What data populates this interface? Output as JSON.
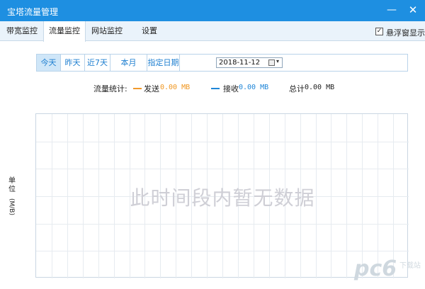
{
  "window": {
    "title": "宝塔流量管理",
    "min_symbol": "—",
    "close_symbol": "✕"
  },
  "tabs": [
    {
      "label": "带宽监控"
    },
    {
      "label": "流量监控"
    },
    {
      "label": "网站监控"
    },
    {
      "label": "设置"
    }
  ],
  "float_window": {
    "label": "悬浮窗显示",
    "checked_mark": "✓"
  },
  "filter": {
    "buttons": [
      {
        "label": "今天"
      },
      {
        "label": "昨天"
      },
      {
        "label": "近7天"
      },
      {
        "label": "本月"
      },
      {
        "label": "指定日期"
      }
    ],
    "date_value": "2018-11-12",
    "dropdown_arrow": "▾"
  },
  "stats": {
    "label": "流量统计:",
    "send_label": "发送",
    "send_value": "0.00 MB",
    "recv_label": "接收",
    "recv_value": "0.00 MB",
    "total_label": "总计",
    "total_value": "0.00 MB"
  },
  "chart": {
    "nodata_text": "此时间段内暂无数据",
    "y_unit_text": "单位",
    "y_unit_value": "(M/B)"
  },
  "watermark": {
    "logo": "pc6",
    "sub": "下载站"
  },
  "colors": {
    "titlebar": "#1e8fe1",
    "send": "#f19a2c",
    "recv": "#1f86d8"
  }
}
